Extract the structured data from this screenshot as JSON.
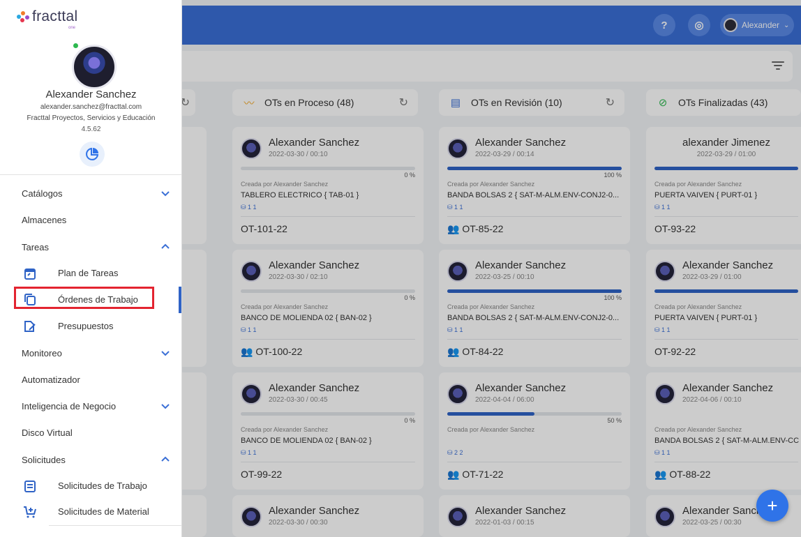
{
  "header": {
    "help_icon": "help-circle-icon",
    "settings_icon": "target-icon",
    "user_name": "Alexander"
  },
  "columns": [
    {
      "label": "OTs en Proceso (48)",
      "icon": "trend-icon"
    },
    {
      "label": "OTs en Revisión (10)",
      "icon": "clipboard-icon"
    },
    {
      "label": "OTs Finalizadas (43)",
      "icon": "check-circle-icon"
    }
  ],
  "cards": {
    "proceso": [
      {
        "name": "Alexander Sanchez",
        "date": "2022-03-30 / 00:10",
        "progress": 0,
        "pct": "0 %",
        "creator": "Creada por Alexander Sanchez",
        "asset": "TABLERO ELECTRICO { TAB-01 }",
        "counts": "1  1",
        "ot": "OT-101-22"
      },
      {
        "name": "Alexander Sanchez",
        "date": "2022-03-30 / 02:10",
        "progress": 0,
        "pct": "0 %",
        "creator": "Creada por Alexander Sanchez",
        "asset": "BANCO DE MOLIENDA 02 { BAN-02 }",
        "counts": "1  1",
        "ot": "OT-100-22"
      },
      {
        "name": "Alexander Sanchez",
        "date": "2022-03-30 / 00:45",
        "progress": 0,
        "pct": "0 %",
        "creator": "Creada por Alexander Sanchez",
        "asset": "BANCO DE MOLIENDA 02 { BAN-02 }",
        "counts": "1  1",
        "ot": "OT-99-22"
      },
      {
        "name": "Alexander Sanchez",
        "date": "2022-03-30 / 00:30"
      }
    ],
    "revision": [
      {
        "name": "Alexander Sanchez",
        "date": "2022-03-29 / 00:14",
        "progress": 100,
        "pct": "100 %",
        "creator": "Creada por Alexander Sanchez",
        "asset": "BANDA BOLSAS 2 { SAT-M-ALM.ENV-CONJ2-0...",
        "counts": "1  1",
        "ot": "OT-85-22"
      },
      {
        "name": "Alexander Sanchez",
        "date": "2022-03-25 / 00:10",
        "progress": 100,
        "pct": "100 %",
        "creator": "Creada por Alexander Sanchez",
        "asset": "BANDA BOLSAS 2 { SAT-M-ALM.ENV-CONJ2-0...",
        "counts": "1  1",
        "ot": "OT-84-22"
      },
      {
        "name": "Alexander Sanchez",
        "date": "2022-04-04 / 06:00",
        "progress": 50,
        "pct": "50 %",
        "creator": "Creada por Alexander Sanchez",
        "asset": "",
        "counts": "2  2",
        "ot": "OT-71-22"
      },
      {
        "name": "Alexander Sanchez",
        "date": "2022-01-03 / 00:15"
      }
    ],
    "finalizadas": [
      {
        "name": "alexander Jimenez",
        "date": "2022-03-29 / 01:00",
        "progress": 100,
        "creator": "Creada por Alexander Sanchez",
        "asset": "PUERTA VAIVEN { PURT-01 }",
        "counts": "1  1",
        "ot": "OT-93-22"
      },
      {
        "name": "Alexander Sanchez",
        "date": "2022-03-29 / 01:00",
        "progress": 100,
        "creator": "Creada por Alexander Sanchez",
        "asset": "PUERTA VAIVEN { PURT-01 }",
        "counts": "1  1",
        "ot": "OT-92-22"
      },
      {
        "name": "Alexander Sanchez",
        "date": "2022-04-06 / 00:10",
        "creator": "Creada por Alexander Sanchez",
        "asset": "BANDA BOLSAS 2 { SAT-M-ALM.ENV-CC",
        "counts": "1  1",
        "ot": "OT-88-22"
      },
      {
        "name": "Alexander Sanche",
        "date": "2022-03-25 / 00:30"
      }
    ]
  },
  "drawer": {
    "logo": "fracttal",
    "logo_sub": "one",
    "profile": {
      "name": "Alexander Sanchez",
      "email": "alexander.sanchez@fracttal.com",
      "company": "Fracttal Proyectos, Servicios y Educación",
      "version": "4.5.62"
    },
    "menu": {
      "catalogos": "Catálogos",
      "almacenes": "Almacenes",
      "tareas": "Tareas",
      "plan_tareas": "Plan de Tareas",
      "ordenes_trabajo": "Órdenes de Trabajo",
      "presupuestos": "Presupuestos",
      "monitoreo": "Monitoreo",
      "automatizador": "Automatizador",
      "inteligencia": "Inteligencia de Negocio",
      "disco_virtual": "Disco Virtual",
      "solicitudes": "Solicitudes",
      "solicitudes_trabajo": "Solicitudes de Trabajo",
      "solicitudes_material": "Solicitudes de Material"
    }
  },
  "fab_label": "+",
  "colors": {
    "primary": "#3a6fd6",
    "accent_blue": "#2f63c6",
    "highlight_red": "#e32430",
    "online": "#2db84f"
  }
}
